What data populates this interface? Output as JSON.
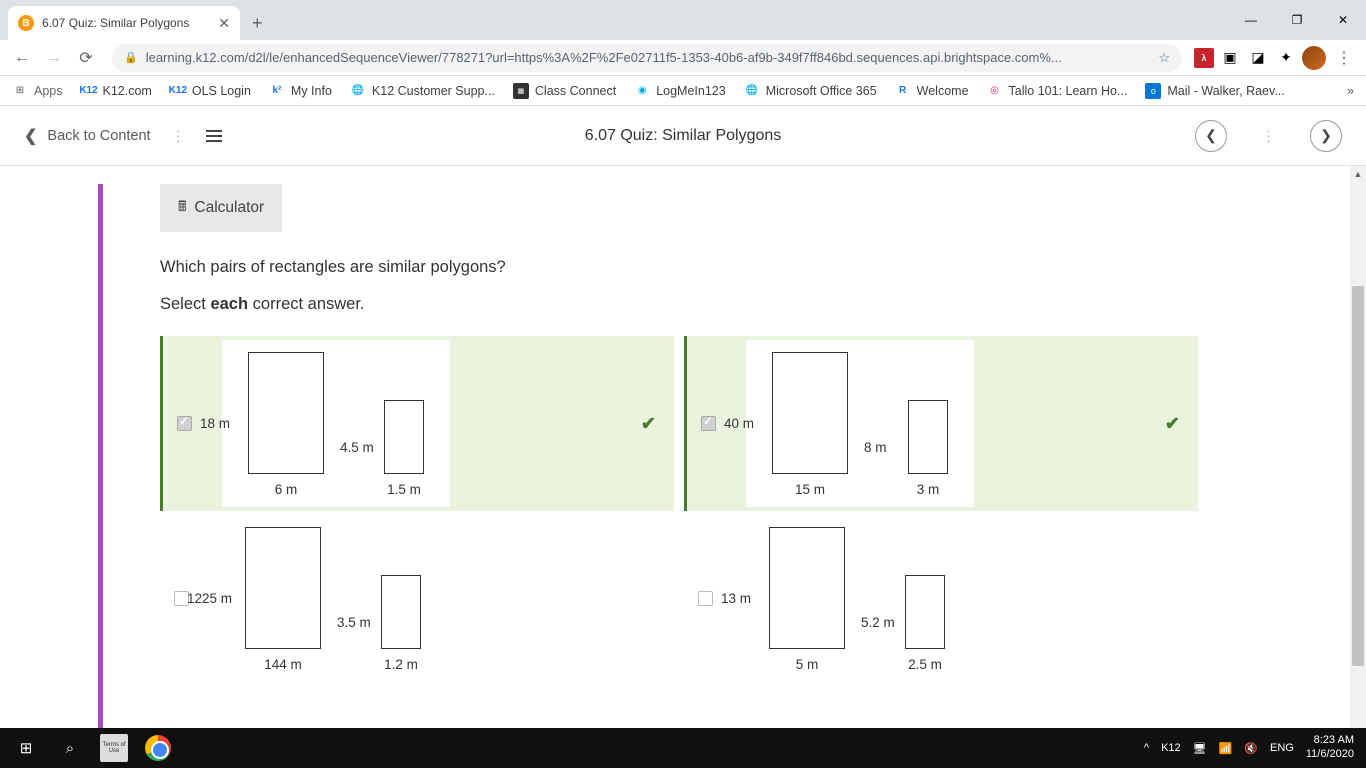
{
  "tab": {
    "title": "6.07 Quiz: Similar Polygons",
    "favicon": "B"
  },
  "window": {
    "min": "—",
    "max": "❐",
    "close": "✕"
  },
  "address": {
    "url": "learning.k12.com/d2l/le/enhancedSequenceViewer/778271?url=https%3A%2F%2Fe02711f5-1353-40b6-af9b-349f7ff846bd.sequences.api.brightspace.com%..."
  },
  "bookmarks": {
    "apps": "Apps",
    "items": [
      "K12.com",
      "OLS Login",
      "My Info",
      "K12 Customer Supp...",
      "Class Connect",
      "LogMeIn123",
      "Microsoft Office 365",
      "Welcome",
      "Tallo 101: Learn Ho...",
      "Mail - Walker, Raev..."
    ]
  },
  "header": {
    "back": "Back to Content",
    "title": "6.07 Quiz: Similar Polygons"
  },
  "calculator": "Calculator",
  "question": "Which pairs of rectangles are similar polygons?",
  "instruction_pre": "Select ",
  "instruction_bold": "each",
  "instruction_post": " correct answer.",
  "answers": [
    {
      "correct": true,
      "big_h": "18 m",
      "big_w": "6 m",
      "sm_h": "4.5 m",
      "sm_w": "1.5 m"
    },
    {
      "correct": true,
      "big_h": "40 m",
      "big_w": "15 m",
      "sm_h": "8 m",
      "sm_w": "3 m"
    },
    {
      "correct": false,
      "big_h": "1225 m",
      "big_w": "144 m",
      "sm_h": "3.5 m",
      "sm_w": "1.2 m"
    },
    {
      "correct": false,
      "big_h": "13 m",
      "big_w": "5 m",
      "sm_h": "5.2 m",
      "sm_w": "2.5 m"
    }
  ],
  "taskbar": {
    "terms": "Terms of Use",
    "k12": "K12",
    "lang": "ENG",
    "time": "8:23 AM",
    "date": "11/6/2020"
  }
}
